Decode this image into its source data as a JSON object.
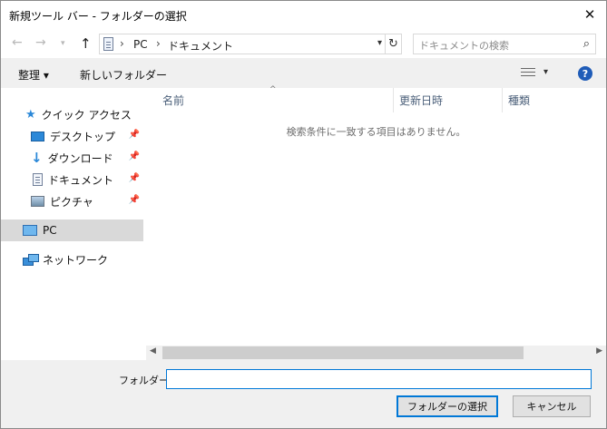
{
  "window": {
    "title": "新規ツール バー - フォルダーの選択"
  },
  "icons": {
    "close": "close-icon",
    "back": "back-arrow-icon",
    "forward": "forward-arrow-icon",
    "up": "up-arrow-icon",
    "search": "search-icon",
    "help": "help-icon"
  },
  "navigation": {
    "breadcrumb": [
      "PC",
      "ドキュメント"
    ],
    "search_placeholder": "ドキュメントの検索"
  },
  "toolbar": {
    "organize_label": "整理 ▾",
    "new_folder_label": "新しいフォルダー"
  },
  "sidebar": {
    "quick_access": "クイック アクセス",
    "items": [
      {
        "label": "デスクトップ",
        "icon": "desktop-icon",
        "pinned": true
      },
      {
        "label": "ダウンロード",
        "icon": "download-icon",
        "pinned": true
      },
      {
        "label": "ドキュメント",
        "icon": "document-icon",
        "pinned": true
      },
      {
        "label": "ピクチャ",
        "icon": "pictures-icon",
        "pinned": true
      }
    ],
    "pc": "PC",
    "network": "ネットワーク"
  },
  "file_list": {
    "columns": [
      "名前",
      "更新日時",
      "種類"
    ],
    "empty_message": "検索条件に一致する項目はありません。"
  },
  "footer": {
    "folder_label": "フォルダー:",
    "folder_value": "",
    "select_button": "フォルダーの選択",
    "cancel_button": "キャンセル"
  },
  "colors": {
    "accent": "#0078d7",
    "selected_bg": "#d9d9d9",
    "bar_bg": "#f0f0f0"
  }
}
